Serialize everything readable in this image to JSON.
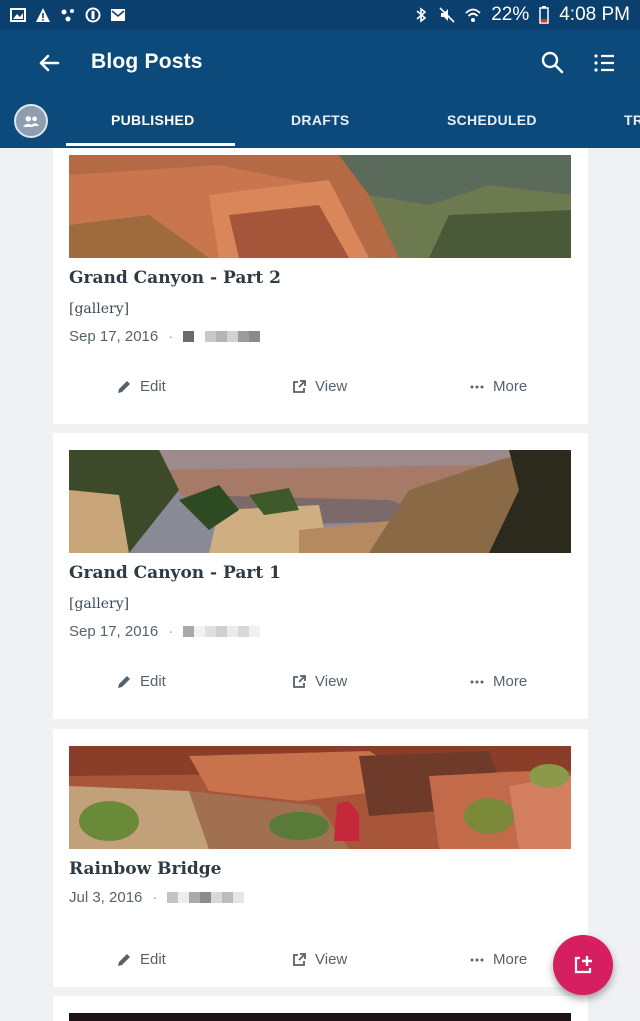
{
  "status_bar": {
    "battery": "22%",
    "time": "4:08 PM"
  },
  "app_bar": {
    "title": "Blog Posts",
    "icons": [
      "back-arrow-icon",
      "search-icon",
      "filter-list-icon"
    ]
  },
  "tabs": [
    {
      "label": "PUBLISHED",
      "active": true
    },
    {
      "label": "DRAFTS",
      "active": false
    },
    {
      "label": "SCHEDULED",
      "active": false
    },
    {
      "label": "TR",
      "active": false
    }
  ],
  "posts": [
    {
      "title": "Grand Canyon - Part 2",
      "excerpt": "[gallery]",
      "date": "Sep 17, 2016",
      "image": "canyon-cliff-photo"
    },
    {
      "title": "Grand Canyon - Part 1",
      "excerpt": "[gallery]",
      "date": "Sep 17, 2016",
      "image": "canyon-vista-photo"
    },
    {
      "title": "Rainbow Bridge",
      "excerpt": "",
      "date": "Jul 3, 2016",
      "image": "red-rock-hiker-photo"
    }
  ],
  "actions": {
    "edit": "Edit",
    "view": "View",
    "more": "More"
  },
  "fab": {
    "icon": "new-post-icon"
  },
  "colors": {
    "status_bar": "#0b3f6e",
    "app_bar": "#0b4a7a",
    "fab": "#d61f5f",
    "background": "#f0f1f3"
  }
}
